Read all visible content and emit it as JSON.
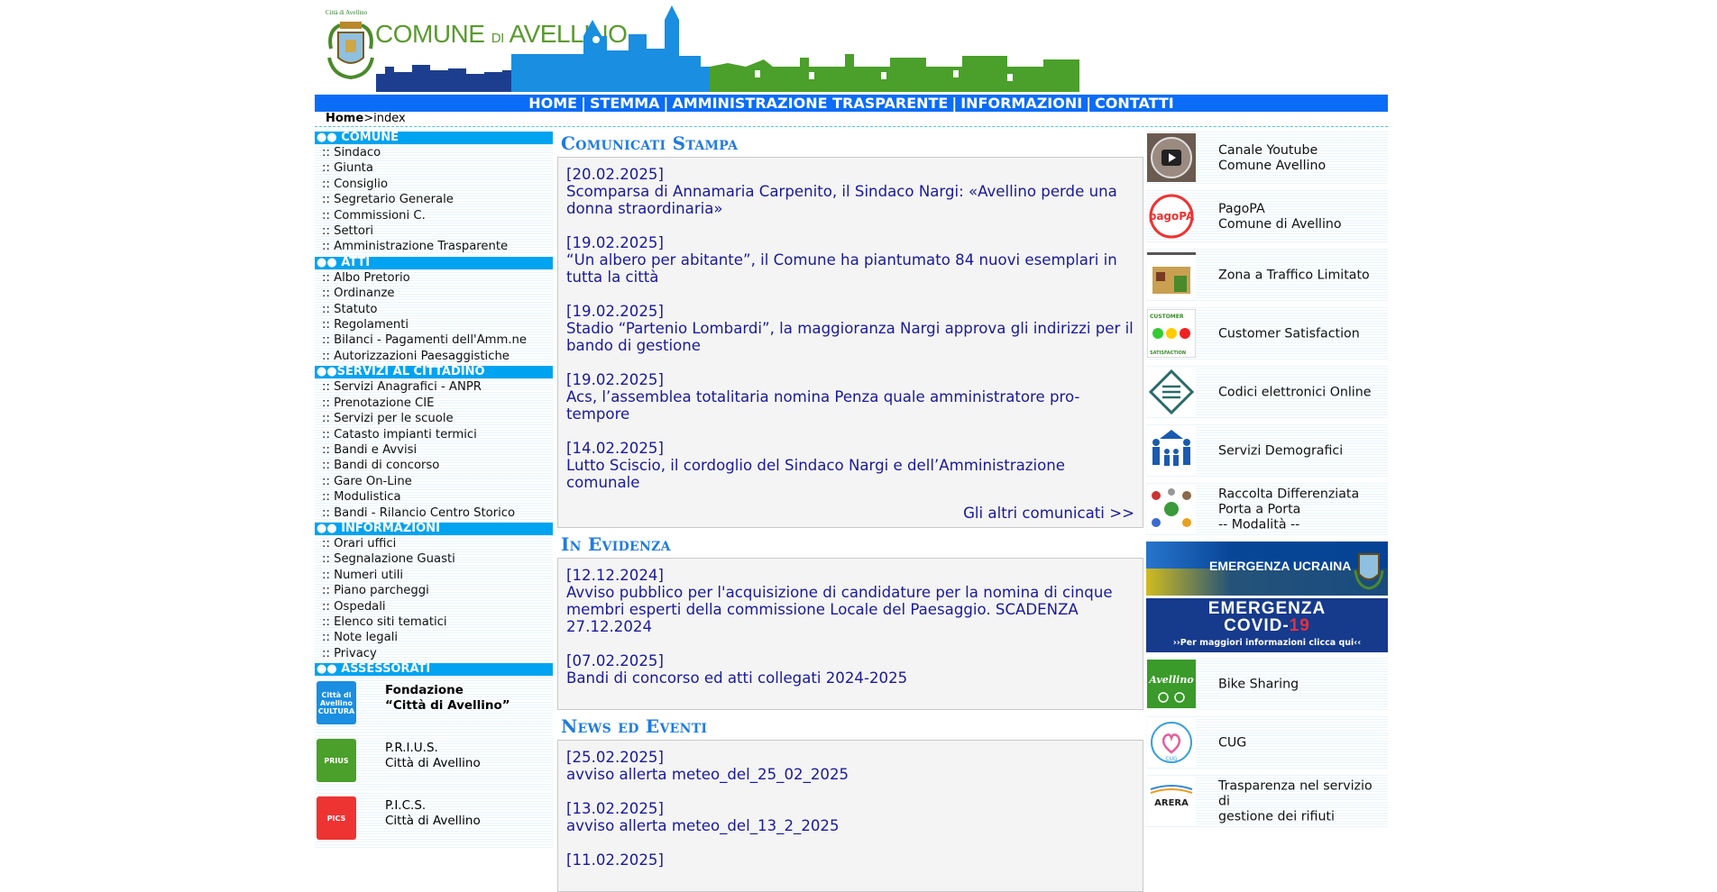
{
  "header": {
    "crest_caption": "Città di Avellino",
    "logo_comune": "COMUNE",
    "logo_di": "DI",
    "logo_city": "AVELLINO"
  },
  "nav": {
    "items": [
      "HOME",
      "STEMMA",
      "AMMINISTRAZIONE TRASPARENTE",
      "INFORMAZIONI",
      "CONTATTI"
    ],
    "separator": "|"
  },
  "breadcrumb": {
    "home": "Home",
    "sep": ">",
    "current": "index"
  },
  "left": {
    "prefix": "::",
    "sections": [
      {
        "title": "●● COMUNE",
        "items": [
          "Sindaco",
          "Giunta",
          "Consiglio",
          "Segretario Generale",
          "Commissioni C.",
          "Settori",
          "Amministrazione Trasparente"
        ]
      },
      {
        "title": "●● ATTI",
        "items": [
          "Albo Pretorio",
          "Ordinanze",
          "Statuto",
          "Regolamenti",
          "Bilanci - Pagamenti dell'Amm.ne",
          "Autorizzazioni Paesaggistiche"
        ]
      },
      {
        "title": "●●SERVIZI AL CITTADINO",
        "items": [
          "Servizi Anagrafici - ANPR",
          "Prenotazione CIE",
          "Servizi per le scuole",
          "Catasto impianti termici",
          "Bandi e Avvisi",
          "Bandi di concorso",
          "Gare On-Line",
          "Modulistica",
          "Bandi - Rilancio Centro Storico"
        ]
      },
      {
        "title": "●● INFORMAZIONI",
        "items": [
          "Orari uffici",
          "Segnalazione Guasti",
          "Numeri utili",
          "Piano parcheggi",
          "Ospedali",
          "Elenco siti tematici",
          "Note legali",
          "Privacy"
        ]
      },
      {
        "title": "●● ASSESSORATI",
        "items": []
      }
    ],
    "promos": [
      {
        "line1": "Fondazione",
        "line2": "“Città di Avellino”",
        "bold": true,
        "logo_text": "Città di Avellino CULTURA"
      },
      {
        "line1": "P.R.I.U.S.",
        "line2": "Città di Avellino",
        "bold": false,
        "logo_text": "PRIUS"
      },
      {
        "line1": "P.I.C.S.",
        "line2": "Città di Avellino",
        "bold": false,
        "logo_text": "PICS"
      }
    ]
  },
  "center": {
    "comunicati": {
      "title": "Comunicati Stampa",
      "items": [
        {
          "date": "[20.02.2025]",
          "text": "Scomparsa di Annamaria Carpenito, il Sindaco Nargi: «Avellino perde una donna straordinaria»"
        },
        {
          "date": "[19.02.2025]",
          "text": "“Un albero per abitante”, il Comune ha piantumato 84 nuovi esemplari in tutta la città"
        },
        {
          "date": "[19.02.2025]",
          "text": "Stadio “Partenio Lombardi”, la maggioranza Nargi approva gli indirizzi per il bando di gestione"
        },
        {
          "date": "[19.02.2025]",
          "text": "Acs, l’assemblea totalitaria nomina Penza quale amministratore pro-tempore"
        },
        {
          "date": "[14.02.2025]",
          "text": "Lutto Sciscio, il cordoglio del Sindaco Nargi e dell’Amministrazione comunale"
        }
      ],
      "more": "Gli altri comunicati >>"
    },
    "evidenza": {
      "title": "In Evidenza",
      "items": [
        {
          "date": "[12.12.2024]",
          "text": "Avviso pubblico per l'acquisizione di candidature per la nomina di cinque membri esperti della commissione Locale del Paesaggio. SCADENZA 27.12.2024"
        },
        {
          "date": "[07.02.2025]",
          "text": "Bandi di concorso ed atti collegati 2024-2025"
        }
      ]
    },
    "eventi": {
      "title": "News ed Eventi",
      "items": [
        {
          "date": "[25.02.2025]",
          "text": "avviso allerta meteo_del_25_02_2025"
        },
        {
          "date": "[13.02.2025]",
          "text": "avviso allerta meteo_del_13_2_2025"
        },
        {
          "date": "[11.02.2025]",
          "text": ""
        }
      ]
    }
  },
  "right": {
    "links": [
      {
        "label": "Canale Youtube\nComune Avellino",
        "icon": "youtube-icon"
      },
      {
        "label": "PagoPA\nComune di Avellino",
        "icon": "pagopa-icon",
        "icon_text": "pagoPA"
      },
      {
        "label": "Zona a Traffico Limitato",
        "icon": "ztl-icon"
      },
      {
        "label": "Customer Satisfaction",
        "icon": "customer-satisfaction-icon",
        "icon_text_top": "CUSTOMER",
        "icon_text_bottom": "SATISFACTION"
      },
      {
        "label": "Codici elettronici Online",
        "icon": "codici-icon"
      },
      {
        "label": "Servizi Demografici",
        "icon": "family-icon"
      },
      {
        "label": "Raccolta Differenziata\nPorta a Porta\n-- Modalità --",
        "icon": "recycle-icon"
      }
    ],
    "banner_ukraine": "EMERGENZA UCRAINA",
    "banner_covid": {
      "line1": "EMERGENZA",
      "line2": "COVID-",
      "line2b": "19",
      "line3": "››Per maggiori informazioni clicca qui‹‹"
    },
    "links2": [
      {
        "label": "Bike Sharing",
        "icon": "bike-sharing-icon",
        "icon_text": "Avellino"
      },
      {
        "label": "CUG",
        "icon": "cug-icon",
        "icon_text": "CUG"
      },
      {
        "label": "Trasparenza nel servizio di\ngestione dei rifiuti",
        "icon": "arera-icon",
        "icon_text": "ARERA"
      }
    ]
  }
}
